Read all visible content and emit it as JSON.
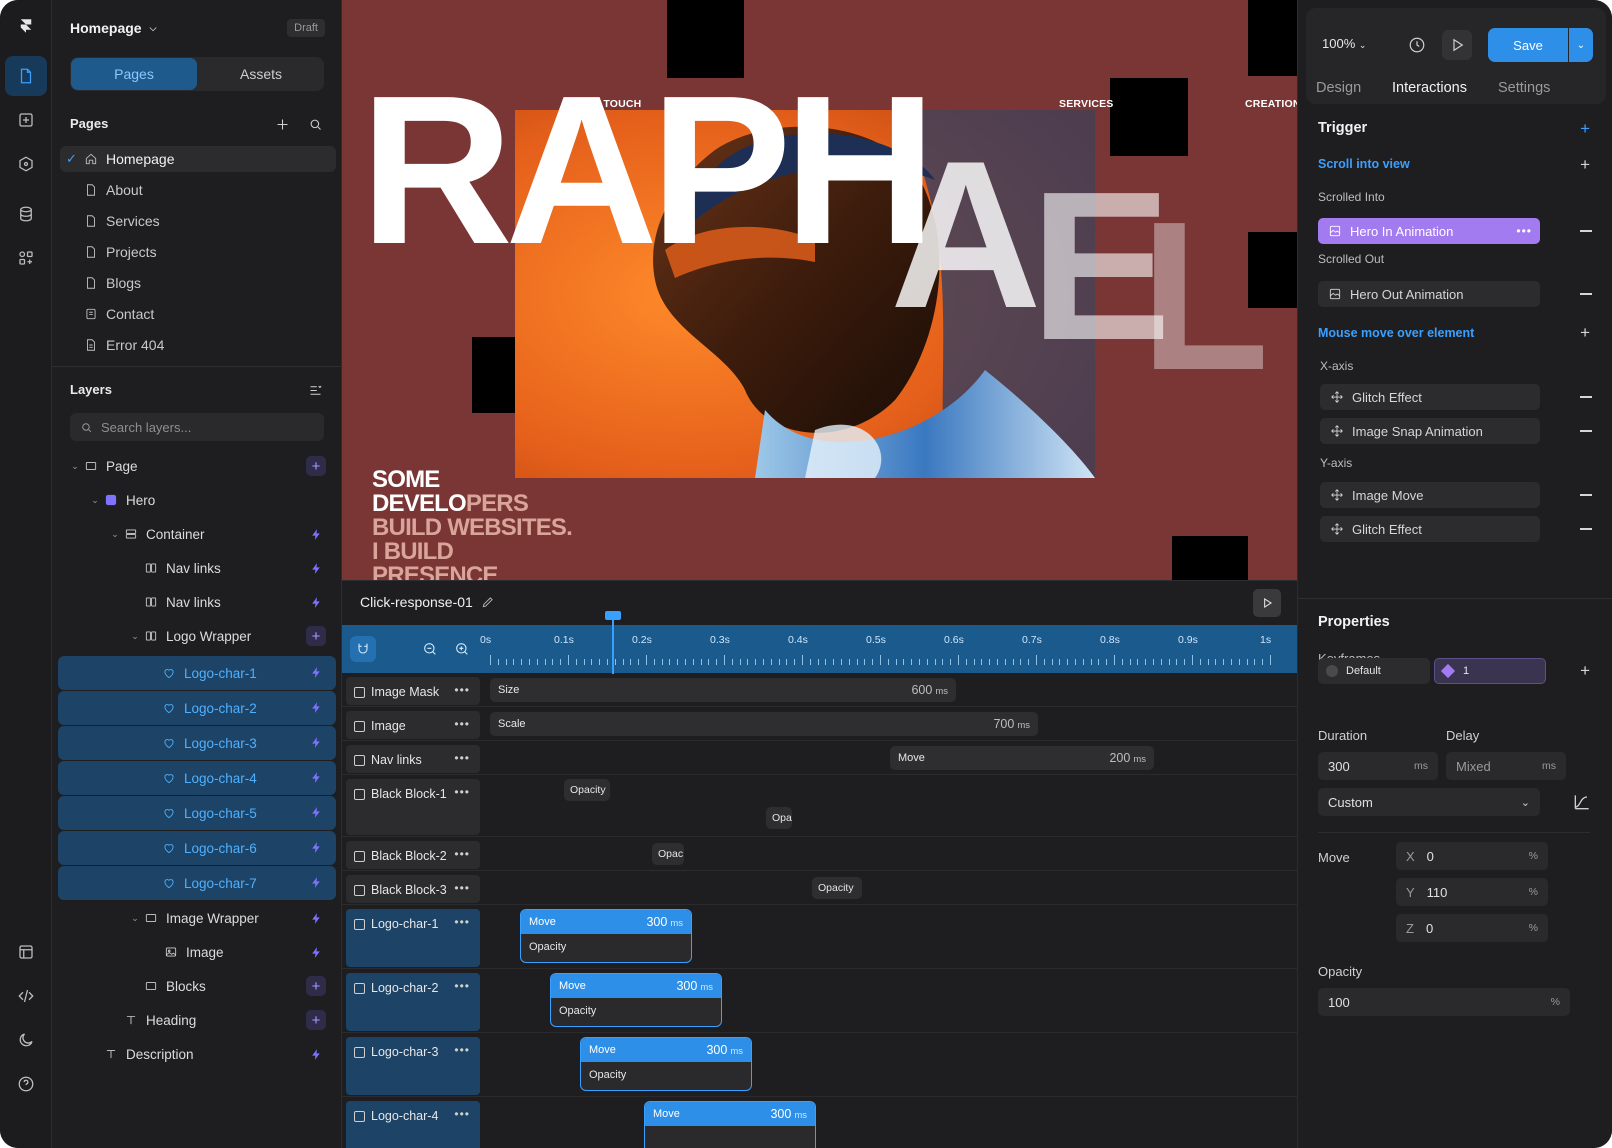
{
  "project": {
    "title": "Homepage",
    "status_badge": "Draft"
  },
  "left_tabs": {
    "pages": "Pages",
    "assets": "Assets"
  },
  "pages_section": {
    "title": "Pages",
    "items": [
      "Homepage",
      "About",
      "Services",
      "Projects",
      "Blogs",
      "Contact",
      "Error 404"
    ],
    "selected": "Homepage"
  },
  "layers_section": {
    "title": "Layers",
    "search_placeholder": "Search layers...",
    "items": [
      "Page",
      "Hero",
      "Container",
      "Nav links",
      "Nav links",
      "Logo Wrapper",
      "Logo-char-1",
      "Logo-char-2",
      "Logo-char-3",
      "Logo-char-4",
      "Logo-char-5",
      "Logo-char-6",
      "Logo-char-7",
      "Image Wrapper",
      "Image",
      "Blocks",
      "Heading",
      "Description"
    ]
  },
  "canvas": {
    "nav": [
      "GET IN TOUCH",
      "SERVICES",
      "CREATIONS"
    ],
    "hero_word": "RAPH",
    "hero_tail": [
      "A",
      "E",
      "L"
    ],
    "body_lines": [
      "SOME",
      "DEVELO",
      "PERS",
      "BUILD WEBSITES.",
      "I BUILD",
      "PRESENCE"
    ],
    "background": "#7a3535"
  },
  "timeline": {
    "name": "Click-response-01",
    "ticks": [
      "0s",
      "0.1s",
      "0.2s",
      "0.3s",
      "0.4s",
      "0.5s",
      "0.6s",
      "0.7s",
      "0.8s",
      "0.9s",
      "1s"
    ],
    "rows": [
      {
        "label": "Image Mask",
        "bar": "Size",
        "value": "600",
        "unit": "ms"
      },
      {
        "label": "Image",
        "bar": "Scale",
        "value": "700",
        "unit": "ms"
      },
      {
        "label": "Nav links",
        "bar": "Move",
        "value": "200",
        "unit": "ms"
      },
      {
        "label": "Black Block-1",
        "pills": [
          "Opacity",
          "Opa"
        ]
      },
      {
        "label": "Black Block-2",
        "pills": [
          "Opac"
        ]
      },
      {
        "label": "Black Block-3",
        "pills": [
          "Opacity"
        ]
      },
      {
        "label": "Logo-char-1",
        "top": "Move",
        "value": "300",
        "unit": "ms",
        "bottom": "Opacity"
      },
      {
        "label": "Logo-char-2",
        "top": "Move",
        "value": "300",
        "unit": "ms",
        "bottom": "Opacity"
      },
      {
        "label": "Logo-char-3",
        "top": "Move",
        "value": "300",
        "unit": "ms",
        "bottom": "Opacity"
      },
      {
        "label": "Logo-char-4",
        "top": "Move",
        "value": "300",
        "unit": "ms"
      }
    ]
  },
  "right": {
    "zoom": "100%",
    "save": "Save",
    "tabs": [
      "Design",
      "Interactions",
      "Settings"
    ],
    "active_tab": "Interactions",
    "trigger": {
      "title": "Trigger",
      "scroll_into_view": "Scroll into view",
      "scrolled_into": "Scrolled Into",
      "hero_in": "Hero In Animation",
      "scrolled_out": "Scrolled Out",
      "hero_out": "Hero Out Animation",
      "mouse_move": "Mouse move over element",
      "x_axis": "X-axis",
      "x_items": [
        "Glitch Effect",
        "Image Snap Animation"
      ],
      "y_axis": "Y-axis",
      "y_items": [
        "Image Move",
        "Glitch Effect"
      ]
    },
    "properties": {
      "title": "Properties",
      "keyframes_label": "Keyframes",
      "kf_default": "Default",
      "kf_one": "1",
      "duration_label": "Duration",
      "delay_label": "Delay",
      "duration_value": "300",
      "duration_unit": "ms",
      "delay_value": "Mixed",
      "delay_unit": "ms",
      "easing": "Custom",
      "move_label": "Move",
      "x": "0",
      "y": "110",
      "z": "0",
      "unit_pct": "%",
      "opacity_label": "Opacity",
      "opacity_value": "100"
    },
    "accent": "#3aa0ff",
    "animation_highlight": "#a37bf0"
  }
}
